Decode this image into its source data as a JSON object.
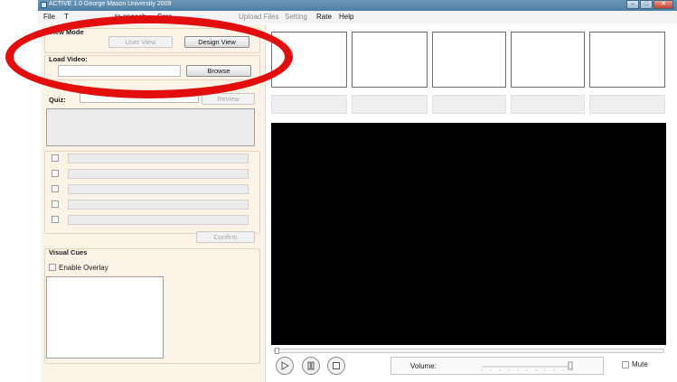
{
  "window": {
    "title": "ACTIVE 1.0 George Mason University 2009"
  },
  "menu": {
    "file": "File",
    "item2": "T",
    "speech": "to speech",
    "screen": "Scre",
    "faded": "...",
    "upload": "Upload Files",
    "setting": "Setting",
    "rate": "Rate",
    "help": "Help"
  },
  "view_mode": {
    "label": "View Mode",
    "user_view": "User View",
    "design_view": "Design View"
  },
  "load_video": {
    "label": "Load Video:",
    "value": "",
    "browse": "Browse"
  },
  "quiz": {
    "label": "Quiz:",
    "review": "Review",
    "confirm": "Confirm",
    "question_text": "",
    "option_count_label": ""
  },
  "visual_cues": {
    "label": "Visual Cues",
    "enable_overlay": "Enable Overlay"
  },
  "player": {
    "volume_label": "Volume:",
    "mute_label": "Mute",
    "volume_level": 0.98
  },
  "colors": {
    "annotation_ring": "#e20d0d",
    "panel_bg": "#fbf4e6"
  }
}
